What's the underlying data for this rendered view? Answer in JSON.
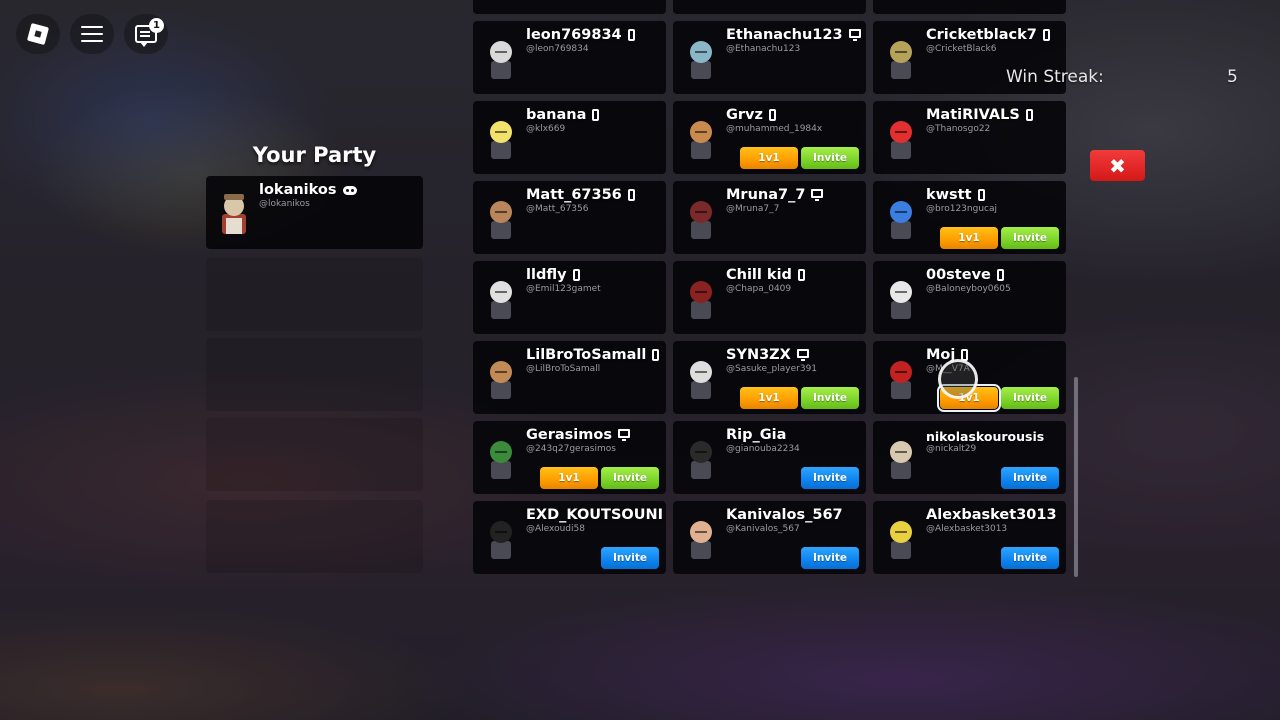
{
  "topbar": {
    "roblox_menu": "roblox-logo-icon",
    "hamburger": "hamburger-menu-icon",
    "chat": "chat-icon",
    "chat_badge": "1"
  },
  "party": {
    "title": "Your Party",
    "members": [
      {
        "name": "lokanikos",
        "handle": "@lokanikos",
        "device": "gamepad"
      }
    ]
  },
  "win_streak": {
    "label": "Win Streak:",
    "value": "5"
  },
  "close_button": {
    "icon": "close-x-icon",
    "symbol": "✖"
  },
  "buttons": {
    "one_v_one": "1v1",
    "invite": "Invite"
  },
  "players": [
    {
      "name": "leon769834",
      "handle": "@leon769834",
      "device": "phone",
      "buttons": "none",
      "avatar_color": "#d9d9d9"
    },
    {
      "name": "Ethanachu123",
      "handle": "@Ethanachu123",
      "device": "pc",
      "buttons": "none",
      "avatar_color": "#8ab6c8"
    },
    {
      "name": "Cricketblack7",
      "handle": "@CricketBlack6",
      "device": "phone",
      "buttons": "none",
      "avatar_color": "#b7a25a"
    },
    {
      "name": "banana",
      "handle": "@klx669",
      "device": "phone",
      "buttons": "none",
      "avatar_color": "#f2e26b"
    },
    {
      "name": "Grvz",
      "handle": "@muhammed_1984x",
      "device": "phone",
      "buttons": "1v1-invite",
      "avatar_color": "#c98a4e"
    },
    {
      "name": "MatiRIVALS",
      "handle": "@Thanosgo22",
      "device": "phone",
      "buttons": "none",
      "avatar_color": "#e23030"
    },
    {
      "name": "Matt_67356",
      "handle": "@Matt_67356",
      "device": "phone",
      "buttons": "none",
      "avatar_color": "#b8865a"
    },
    {
      "name": "Mruna7_7",
      "handle": "@Mruna7_7",
      "device": "pc",
      "buttons": "none",
      "avatar_color": "#7a2a2a"
    },
    {
      "name": "kwstt",
      "handle": "@bro123ngucaj",
      "device": "phone",
      "buttons": "1v1-invite",
      "avatar_color": "#3a7ee0"
    },
    {
      "name": "lldfly",
      "handle": "@Emil123gamet",
      "device": "phone",
      "buttons": "none",
      "avatar_color": "#e0e0e0"
    },
    {
      "name": "Chill kid",
      "handle": "@Chapa_0409",
      "device": "phone",
      "buttons": "none",
      "avatar_color": "#8a2222"
    },
    {
      "name": "00steve",
      "handle": "@Baloneyboy0605",
      "device": "phone",
      "buttons": "none",
      "avatar_color": "#e8e8e8"
    },
    {
      "name": "LilBroToSamall",
      "handle": "@LilBroToSamall",
      "device": "phone",
      "buttons": "none",
      "avatar_color": "#c28a55"
    },
    {
      "name": "SYN3ZX",
      "handle": "@Sasuke_player391",
      "device": "pc",
      "buttons": "1v1-invite",
      "avatar_color": "#dddddd"
    },
    {
      "name": "Moj",
      "handle": "@M__V7A",
      "device": "phone",
      "buttons": "1v1-invite-selected",
      "avatar_color": "#c22222"
    },
    {
      "name": "Gerasimos",
      "handle": "@243q27gerasimos",
      "device": "pc",
      "buttons": "1v1-invite",
      "avatar_color": "#3c8a3c"
    },
    {
      "name": "Rip_Gia",
      "handle": "@gianouba2234",
      "device": "none",
      "buttons": "invite-blue",
      "avatar_color": "#2a2a2a"
    },
    {
      "name": "nikolaskourousis",
      "handle": "@nickalt29",
      "device": "none",
      "buttons": "invite-blue",
      "avatar_color": "#d8c8b0"
    },
    {
      "name": "EXD_KOUTSOUNI",
      "handle": "@Alexoudi58",
      "device": "none",
      "buttons": "invite-blue",
      "avatar_color": "#222222"
    },
    {
      "name": "Kanivalos_567",
      "handle": "@Kanivalos_567",
      "device": "none",
      "buttons": "invite-blue",
      "avatar_color": "#e0b090"
    },
    {
      "name": "Alexbasket3013",
      "handle": "@Alexbasket3013",
      "device": "none",
      "buttons": "invite-blue",
      "avatar_color": "#e8d040"
    }
  ],
  "top_row_partial": {
    "count": 3
  }
}
